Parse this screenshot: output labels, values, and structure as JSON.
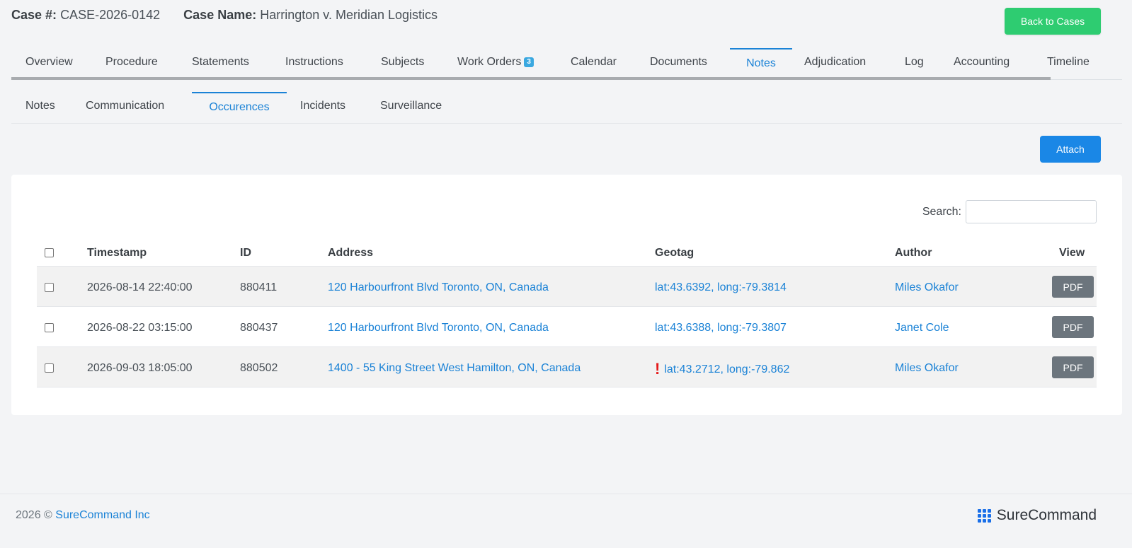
{
  "header": {
    "case_num_label": "Case #:",
    "case_num": "CASE-2026-0142",
    "case_name_label": "Case Name:",
    "case_name": "Harrington v. Meridian Logistics",
    "back_label": "Back to Cases"
  },
  "main_tabs": [
    {
      "label": "Overview"
    },
    {
      "label": "Procedure"
    },
    {
      "label": "Statements"
    },
    {
      "label": "Instructions"
    },
    {
      "label": "Subjects"
    },
    {
      "label": "Work Orders",
      "badge": "3"
    },
    {
      "label": "Calendar"
    },
    {
      "label": "Documents"
    },
    {
      "label": "Notes",
      "active": true
    },
    {
      "label": "Adjudication"
    },
    {
      "label": "Log"
    },
    {
      "label": "Accounting"
    },
    {
      "label": "Timeline"
    }
  ],
  "sub_tabs": [
    {
      "label": "Notes"
    },
    {
      "label": "Communication"
    },
    {
      "label": "Occurences",
      "active": true
    },
    {
      "label": "Incidents"
    },
    {
      "label": "Surveillance"
    }
  ],
  "attach_label": "Attach",
  "search": {
    "label": "Search:",
    "value": ""
  },
  "table": {
    "headers": {
      "timestamp": "Timestamp",
      "id": "ID",
      "address": "Address",
      "geotag": "Geotag",
      "author": "Author",
      "view": "View"
    },
    "rows": [
      {
        "timestamp": "2026-08-14 22:40:00",
        "id": "880411",
        "address": "120 Harbourfront Blvd Toronto, ON, Canada",
        "geotag": "lat:43.6392, long:-79.3814",
        "warning": false,
        "author": "Miles Okafor",
        "view": "PDF"
      },
      {
        "timestamp": "2026-08-22 03:15:00",
        "id": "880437",
        "address": "120 Harbourfront Blvd Toronto, ON, Canada",
        "geotag": "lat:43.6388, long:-79.3807",
        "warning": false,
        "author": "Janet Cole",
        "view": "PDF"
      },
      {
        "timestamp": "2026-09-03 18:05:00",
        "id": "880502",
        "address": "1400 - 55 King Street West Hamilton, ON, Canada",
        "geotag": "lat:43.2712, long:-79.862",
        "warning": true,
        "warning_glyph": "!",
        "author": "Miles Okafor",
        "view": "PDF"
      }
    ]
  },
  "footer": {
    "year": "2026 ©",
    "company": "SureCommand Inc",
    "brand": "SureCommand"
  },
  "icons": {
    "brand_logo": "grid-dots-icon",
    "warning": "exclamation-icon"
  },
  "colors": {
    "accent": "#1a82d6",
    "success": "#2ecc71",
    "primary_button": "#1a87e6",
    "secondary_button": "#6c757d",
    "warning": "#e41a1a"
  }
}
